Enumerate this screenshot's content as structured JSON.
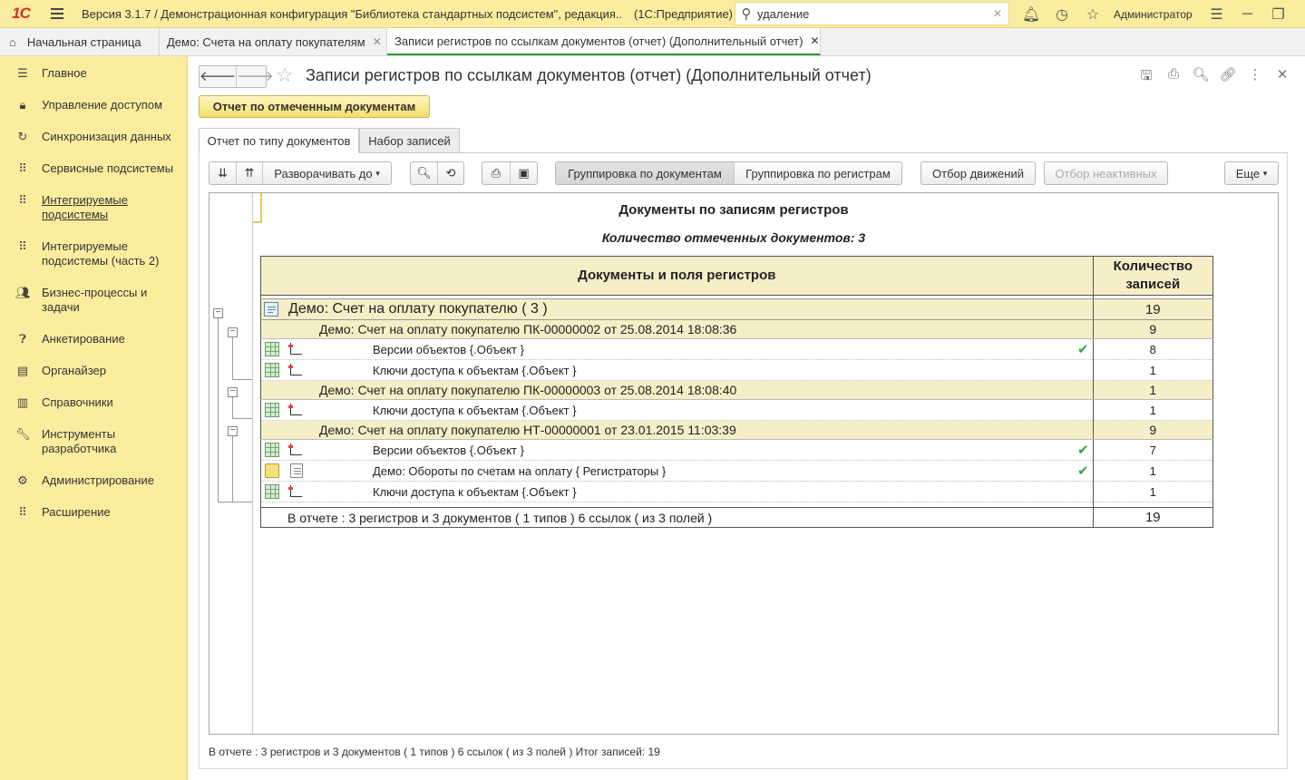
{
  "topbar": {
    "logo": "1С",
    "title": "Версия 3.1.7 / Демонстрационная конфигурация \"Библиотека стандартных подсистем\", редакция...",
    "mode": "(1С:Предприятие)",
    "search_value": "удаление",
    "user": "Администратор"
  },
  "open_tabs": [
    {
      "label": "Начальная страница"
    },
    {
      "label": "Демо: Счета на оплату покупателям"
    },
    {
      "label": "Записи регистров по ссылкам документов (отчет) (Дополнительный отчет)"
    }
  ],
  "sidebar": {
    "items": [
      {
        "label": "Главное",
        "icon": "list-icon"
      },
      {
        "label": "Управление доступом",
        "icon": "lock-icon"
      },
      {
        "label": "Синхронизация данных",
        "icon": "sync-icon"
      },
      {
        "label": "Сервисные подсистемы",
        "icon": "grid-icon"
      },
      {
        "label": "Интегрируемые подсистемы",
        "icon": "grid-icon"
      },
      {
        "label": "Интегрируемые подсистемы (часть 2)",
        "icon": "grid-icon"
      },
      {
        "label": "Бизнес-процессы и задачи",
        "icon": "people-icon"
      },
      {
        "label": "Анкетирование",
        "icon": "question-icon"
      },
      {
        "label": "Органайзер",
        "icon": "notebook-icon"
      },
      {
        "label": "Справочники",
        "icon": "books-icon"
      },
      {
        "label": "Инструменты разработчика",
        "icon": "wrench-icon"
      },
      {
        "label": "Администрирование",
        "icon": "gear-icon"
      },
      {
        "label": "Расширение",
        "icon": "grid-icon"
      }
    ]
  },
  "form": {
    "title": "Записи регистров по ссылкам документов (отчет) (Дополнительный отчет)",
    "report_button": "Отчет по отмеченным документам",
    "tabs": [
      "Отчет по типу документов",
      "Набор записей"
    ],
    "toolbar": {
      "expand": "Разворачивать до",
      "group_docs": "Группировка по документам",
      "group_regs": "Группировка по регистрам",
      "filter_moves": "Отбор движений",
      "filter_inactive": "Отбор неактивных",
      "more": "Еще"
    }
  },
  "report": {
    "title": "Документы по записям регистров",
    "subtitle": "Количество отмеченных документов: 3",
    "col_doc": "Документы и поля регистров",
    "col_count": "Количество записей",
    "group": {
      "label": "Демо: Счет на оплату покупателю ( 3 )",
      "count": "19"
    },
    "docs": [
      {
        "label": "Демо: Счет на оплату покупателю ПК-00000002 от 25.08.2014 18:08:36",
        "count": "9",
        "rows": [
          {
            "label": "Версии объектов {.Объект }",
            "count": "8",
            "check": "✔"
          },
          {
            "label": "Ключи доступа к объектам {.Объект }",
            "count": "1"
          }
        ]
      },
      {
        "label": "Демо: Счет на оплату покупателю ПК-00000003 от 25.08.2014 18:08:40",
        "count": "1",
        "rows": [
          {
            "label": "Ключи доступа к объектам {.Объект }",
            "count": "1"
          }
        ]
      },
      {
        "label": "Демо: Счет на оплату покупателю НТ-00000001 от 23.01.2015 11:03:39",
        "count": "9",
        "rows": [
          {
            "label": "Версии объектов {.Объект }",
            "count": "7",
            "check": "✔"
          },
          {
            "label": "Демо: Обороты по счетам на оплату { Регистраторы }",
            "count": "1",
            "check": "✔"
          },
          {
            "label": "Ключи доступа к объектам {.Объект }",
            "count": "1"
          }
        ]
      }
    ],
    "total_label": "В отчете : 3 регистров и 3 документов ( 1 типов )  6 ссылок ( из 3 полей )",
    "total_count": "19"
  },
  "footer": "В отчете : 3 регистров и 3 документов ( 1 типов )  6 ссылок ( из 3 полей )  Итог записей: 19"
}
